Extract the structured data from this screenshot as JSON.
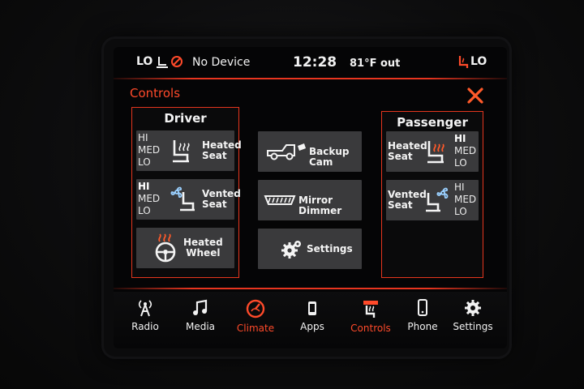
{
  "status": {
    "fan_level": "LO",
    "device": "No Device",
    "time": "12:28",
    "temperature": "81°F out",
    "passenger_level": "LO"
  },
  "title": "Controls",
  "driver": {
    "heading": "Driver",
    "heated_seat": {
      "levels": [
        "HI",
        "MED",
        "LO"
      ],
      "label_line1": "Heated",
      "label_line2": "Seat"
    },
    "vented_seat": {
      "levels": [
        "HI",
        "MED",
        "LO"
      ],
      "label_line1": "Vented",
      "label_line2": "Seat"
    },
    "heated_wheel": {
      "label_line1": "Heated",
      "label_line2": "Wheel"
    }
  },
  "center": {
    "backup_cam": "Backup Cam",
    "mirror_dimmer": "Mirror Dimmer",
    "settings": "Settings"
  },
  "passenger": {
    "heading": "Passenger",
    "heated_seat": {
      "levels": [
        "HI",
        "MED",
        "LO"
      ],
      "label_line1": "Heated",
      "label_line2": "Seat"
    },
    "vented_seat": {
      "levels": [
        "HI",
        "MED",
        "LO"
      ],
      "label_line1": "Vented",
      "label_line2": "Seat"
    }
  },
  "nav": {
    "radio": "Radio",
    "media": "Media",
    "climate": "Climate",
    "apps": "Apps",
    "controls": "Controls",
    "phone": "Phone",
    "settings": "Settings"
  },
  "colors": {
    "accent": "#e8351f",
    "button": "#3a3a3c",
    "text": "#f4f4f4",
    "heat": "#ff5a2a"
  }
}
